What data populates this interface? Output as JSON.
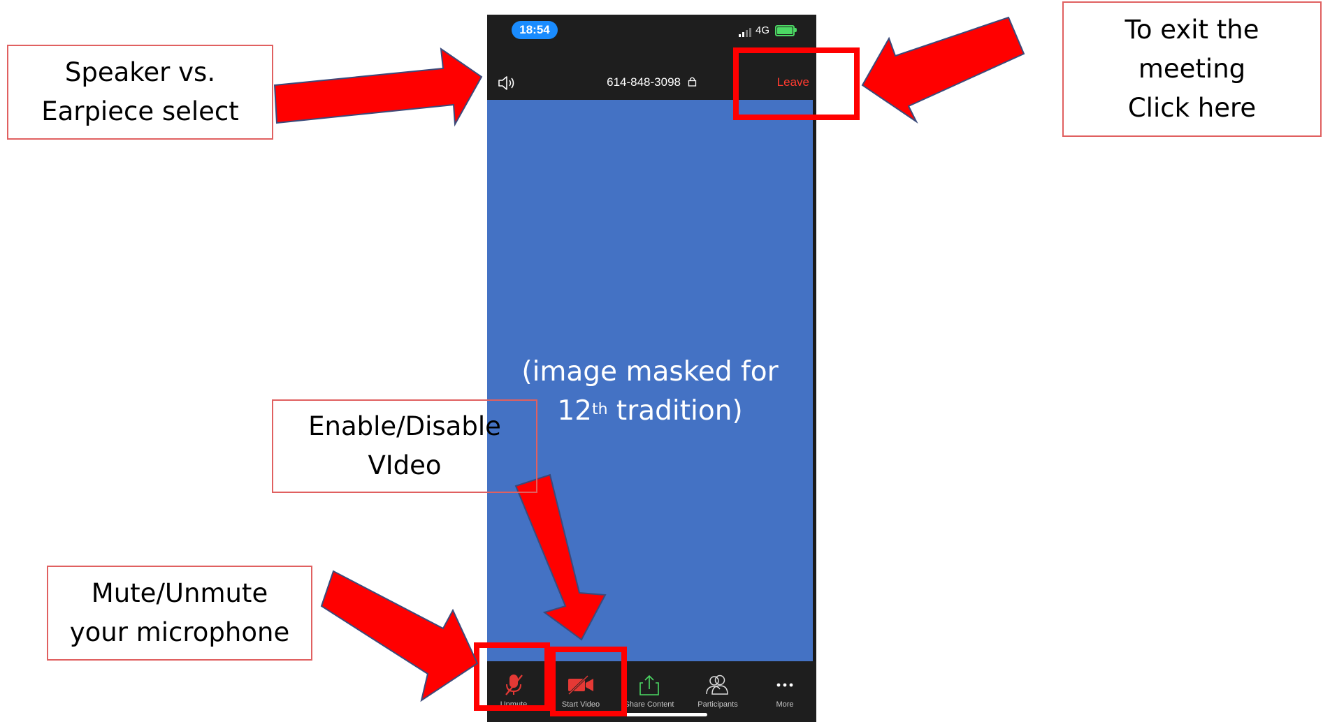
{
  "status_bar": {
    "time": "18:54",
    "network": "4G"
  },
  "meeting_header": {
    "meeting_id": "614-848-3098",
    "lock_glyph": "🔒",
    "leave_label": "Leave"
  },
  "video": {
    "masked_line1": "(image masked for",
    "masked_line2_prefix": "12",
    "masked_line2_sup": "th",
    "masked_line2_suffix": " tradition)"
  },
  "toolbar": {
    "unmute_label": "Unmute",
    "start_video_label": "Start Video",
    "share_label": "Share Content",
    "participants_label": "Participants",
    "more_label": "More"
  },
  "annotations": {
    "speaker": {
      "line1": "Speaker vs.",
      "line2": "Earpiece select"
    },
    "exit": {
      "line1": "To exit the",
      "line2": "meeting",
      "line3": "Click here"
    },
    "video": {
      "line1": "Enable/Disable",
      "line2": "VIdeo"
    },
    "mute": {
      "line1": "Mute/Unmute",
      "line2": "your microphone"
    }
  },
  "colors": {
    "accent_red": "#ff0000",
    "video_blue": "#4472c4",
    "leave_red": "#ff3b30",
    "share_green": "#4cd964"
  },
  "icons": [
    "speaker-icon",
    "lock-icon",
    "microphone-muted-icon",
    "video-off-icon",
    "share-icon",
    "participants-icon",
    "more-icon",
    "arrow-icon"
  ]
}
